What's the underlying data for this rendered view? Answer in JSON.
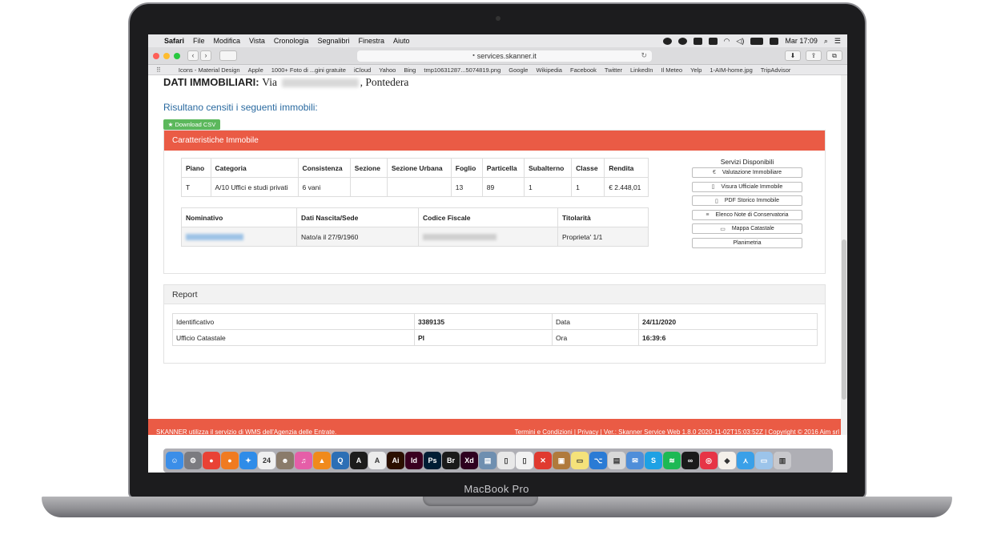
{
  "device": {
    "brand": "MacBook Pro"
  },
  "menubar": {
    "app": "Safari",
    "items": [
      "File",
      "Modifica",
      "Vista",
      "Cronologia",
      "Segnalibri",
      "Finestra",
      "Aiuto"
    ],
    "clock": "Mar 17:09"
  },
  "toolbar": {
    "url": "services.skanner.it"
  },
  "bookmarks": [
    "Icons - Material Design",
    "Apple",
    "1000+ Foto di ...gini gratuite",
    "iCloud",
    "Yahoo",
    "Bing",
    "tmp10631287...5074819.png",
    "Google",
    "Wikipedia",
    "Facebook",
    "Twitter",
    "LinkedIn",
    "Il Meteo",
    "Yelp",
    "1-AIM-home.jpg",
    "TripAdvisor"
  ],
  "page": {
    "title_bold": "DATI IMMOBILIARI:",
    "title_via": "Via",
    "title_city": ", Pontedera",
    "subtitle": "Risultano censiti i seguenti immobili:",
    "csv_button": "★ Download CSV",
    "panel_title": "Caratteristiche Immobile",
    "table1": {
      "headers": [
        "Piano",
        "Categoria",
        "Consistenza",
        "Sezione",
        "Sezione Urbana",
        "Foglio",
        "Particella",
        "Subalterno",
        "Classe",
        "Rendita"
      ],
      "row": [
        "T",
        "A/10 Uffici e studi privati",
        "6 vani",
        "",
        "",
        "13",
        "89",
        "1",
        "1",
        "€ 2.448,01"
      ]
    },
    "table2": {
      "headers": [
        "Nominativo",
        "Dati Nascita/Sede",
        "Codice Fiscale",
        "Titolarità"
      ],
      "row": [
        "",
        "Nato/a il 27/9/1960",
        "",
        "Proprieta' 1/1"
      ]
    },
    "services": {
      "title": "Servizi Disponibili",
      "items": [
        {
          "icon": "€",
          "label": "Valutazione Immobiliare"
        },
        {
          "icon": "▯",
          "label": "Visura Ufficiale Immobile"
        },
        {
          "icon": "▯",
          "label": "PDF Storico Immobile"
        },
        {
          "icon": "≡",
          "label": "Elenco Note di Conservatoria"
        },
        {
          "icon": "▭",
          "label": "Mappa Catastale"
        },
        {
          "icon": "",
          "label": "Planimetria"
        }
      ]
    },
    "report": {
      "title": "Report",
      "rows": [
        [
          "Identificativo",
          "3389135",
          "Data",
          "24/11/2020"
        ],
        [
          "Ufficio Catastale",
          "PI",
          "Ora",
          "16:39:6"
        ]
      ]
    },
    "footer": {
      "left": "SKANNER utilizza il servizio di WMS dell'Agenzia delle Entrate.",
      "right": "Termini e Condizioni  |  Privacy  |  Ver.: Skanner Service Web 1.8.0 2020-11-02T15:03:52Z  |  Copyright © 2016 Aim srl"
    }
  },
  "dock": {
    "apps": [
      {
        "name": "finder",
        "glyph": "☺",
        "color": "#3b8ee8"
      },
      {
        "name": "system-preferences",
        "glyph": "⚙",
        "color": "#7b7b80"
      },
      {
        "name": "chrome",
        "glyph": "●",
        "color": "#e94235"
      },
      {
        "name": "firefox",
        "glyph": "●",
        "color": "#f07b21"
      },
      {
        "name": "safari",
        "glyph": "✦",
        "color": "#2f8ce8"
      },
      {
        "name": "calendar",
        "glyph": "24",
        "color": "#f0f0f0"
      },
      {
        "name": "contacts",
        "glyph": "☻",
        "color": "#8a7b6a"
      },
      {
        "name": "itunes",
        "glyph": "♫",
        "color": "#e55ea8"
      },
      {
        "name": "vlc",
        "glyph": "▲",
        "color": "#f08a1c"
      },
      {
        "name": "quicktime",
        "glyph": "Q",
        "color": "#2c6fb5"
      },
      {
        "name": "acrobat",
        "glyph": "A",
        "color": "#1c1c1c"
      },
      {
        "name": "acrobat-reader",
        "glyph": "A",
        "color": "#ececec"
      },
      {
        "name": "illustrator",
        "glyph": "Ai",
        "color": "#2b0f00"
      },
      {
        "name": "indesign",
        "glyph": "Id",
        "color": "#3a0020"
      },
      {
        "name": "photoshop",
        "glyph": "Ps",
        "color": "#001d34"
      },
      {
        "name": "bridge",
        "glyph": "Br",
        "color": "#1a1a1a"
      },
      {
        "name": "xd",
        "glyph": "Xd",
        "color": "#2e001f"
      },
      {
        "name": "preview",
        "glyph": "▤",
        "color": "#6f8fb0"
      },
      {
        "name": "document",
        "glyph": "▯",
        "color": "#e8e8e8"
      },
      {
        "name": "document-2",
        "glyph": "▯",
        "color": "#f2f2f2"
      },
      {
        "name": "tool",
        "glyph": "✕",
        "color": "#e03a2f"
      },
      {
        "name": "archive",
        "glyph": "▣",
        "color": "#b07a3c"
      },
      {
        "name": "notes",
        "glyph": "▭",
        "color": "#f5e27a"
      },
      {
        "name": "vscode",
        "glyph": "⌥",
        "color": "#2a7bd5"
      },
      {
        "name": "textedit",
        "glyph": "▤",
        "color": "#d8d8d8"
      },
      {
        "name": "mail",
        "glyph": "✉",
        "color": "#4f8ed9"
      },
      {
        "name": "skype",
        "glyph": "S",
        "color": "#1ea1e4"
      },
      {
        "name": "spotify",
        "glyph": "≋",
        "color": "#1db954"
      },
      {
        "name": "adobe-cc",
        "glyph": "∞",
        "color": "#1a1a1a"
      },
      {
        "name": "creative-cloud",
        "glyph": "◎",
        "color": "#e63446"
      },
      {
        "name": "app-orange",
        "glyph": "◆",
        "color": "#f4f0ea"
      },
      {
        "name": "testflight",
        "glyph": "⋏",
        "color": "#3aa0e8"
      },
      {
        "name": "folder",
        "glyph": "▭",
        "color": "#9cc4ea"
      },
      {
        "name": "trash",
        "glyph": "▥",
        "color": "#c8c8cc"
      }
    ]
  }
}
